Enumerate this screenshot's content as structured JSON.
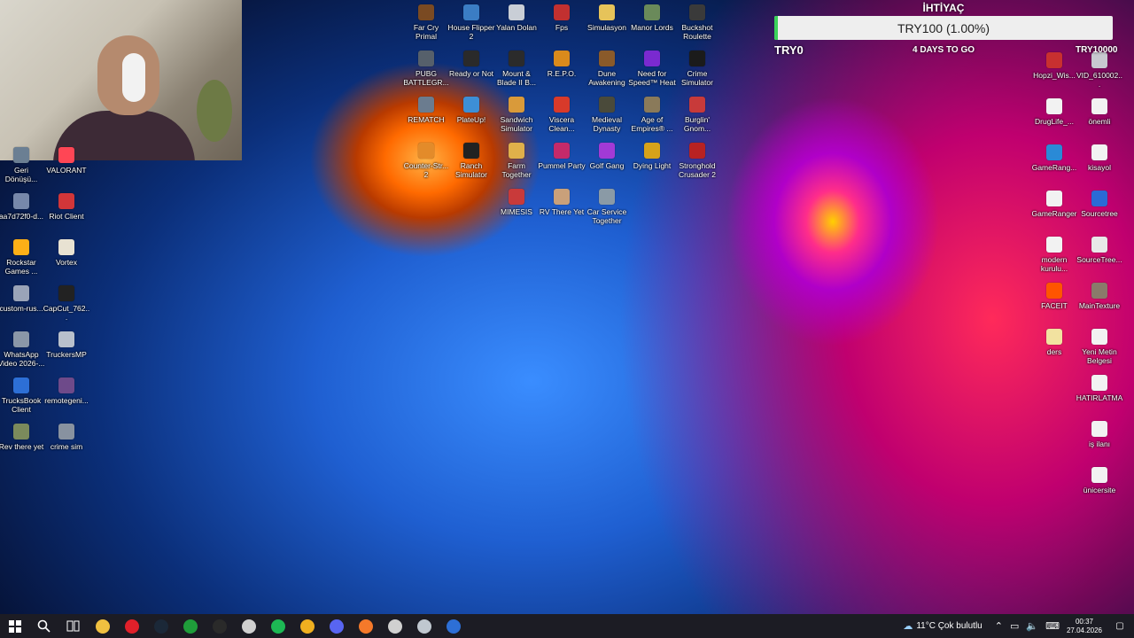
{
  "desktop": {
    "icons_left": [
      {
        "label": "Geri Dönüşü...",
        "icon": "recycle-bin-icon",
        "color": "#6b7f93"
      },
      {
        "label": "VALORANT",
        "icon": "valorant-icon",
        "color": "#ff4655"
      },
      {
        "label": "aa7d72f0-d...",
        "icon": "file-icon",
        "color": "#7788aa"
      },
      {
        "label": "Riot Client",
        "icon": "riot-client-icon",
        "color": "#d13639"
      },
      {
        "label": "Rockstar Games ...",
        "icon": "rockstar-icon",
        "color": "#fcaf17"
      },
      {
        "label": "Vortex",
        "icon": "vortex-icon",
        "color": "#e8e2d2"
      },
      {
        "label": "custom-rus...",
        "icon": "file-icon",
        "color": "#9aa4b8"
      },
      {
        "label": "CapCut_762...",
        "icon": "capcut-icon",
        "color": "#222222"
      },
      {
        "label": "WhatsApp Video 2026-...",
        "icon": "video-file-icon",
        "color": "#8a97a8"
      },
      {
        "label": "TruckersMP",
        "icon": "truckersmp-icon",
        "color": "#b8c0cc"
      },
      {
        "label": "TrucksBook Client",
        "icon": "trucksbook-icon",
        "color": "#2d6fd6"
      },
      {
        "label": "remotegeni...",
        "icon": "remotegenie-icon",
        "color": "#6e4a8a"
      },
      {
        "label": "Rev there yet",
        "icon": "shortcut-icon",
        "color": "#7b8a5c"
      },
      {
        "label": "crime sim",
        "icon": "shortcut-icon",
        "color": "#8892a0"
      }
    ],
    "icons_top": [
      {
        "label": "Far Cry Primal",
        "icon": "far-cry-primal-icon",
        "color": "#7a4a22"
      },
      {
        "label": "House Flipper 2",
        "icon": "house-flipper-icon",
        "color": "#3b7dc4"
      },
      {
        "label": "Yalan Dolan",
        "icon": "file-icon",
        "color": "#c9ced6"
      },
      {
        "label": "Fps",
        "icon": "fps-icon",
        "color": "#c23030"
      },
      {
        "label": "Simulasyon",
        "icon": "folder-icon",
        "color": "#e6c35a"
      },
      {
        "label": "Manor Lords",
        "icon": "manor-lords-icon",
        "color": "#6a8a5a"
      },
      {
        "label": "Buckshot Roulette",
        "icon": "buckshot-roulette-icon",
        "color": "#3a3a3a"
      },
      {
        "label": "PUBG BATTLEGR...",
        "icon": "pubg-icon",
        "color": "#56606b"
      },
      {
        "label": "Ready or Not",
        "icon": "ready-or-not-icon",
        "color": "#2a2a2a"
      },
      {
        "label": "Mount & Blade II B...",
        "icon": "mount-blade-icon",
        "color": "#2b2b2b"
      },
      {
        "label": "R.E.P.O.",
        "icon": "repo-icon",
        "color": "#d98a1c"
      },
      {
        "label": "Dune Awakening",
        "icon": "dune-icon",
        "color": "#8a5a2a"
      },
      {
        "label": "Need for Speed™ Heat",
        "icon": "nfs-heat-icon",
        "color": "#7a2ad0"
      },
      {
        "label": "Crime Simulator",
        "icon": "crime-simulator-icon",
        "color": "#1b1b1b"
      },
      {
        "label": "REMATCH",
        "icon": "rematch-icon",
        "color": "#6b7c8f"
      },
      {
        "label": "PlateUp!",
        "icon": "plateup-icon",
        "color": "#3d8fd6"
      },
      {
        "label": "Sandwich Simulator",
        "icon": "sandwich-icon",
        "color": "#d99a3a"
      },
      {
        "label": "Viscera Clean...",
        "icon": "viscera-icon",
        "color": "#d83a2a"
      },
      {
        "label": "Medieval Dynasty",
        "icon": "medieval-dynasty-icon",
        "color": "#4a4a3a"
      },
      {
        "label": "Age of Empires® ...",
        "icon": "aoe-icon",
        "color": "#8a7a5a"
      },
      {
        "label": "Burglin' Gnom...",
        "icon": "burglin-gnomes-icon",
        "color": "#c83a3a"
      },
      {
        "label": "Counter-Str... 2",
        "icon": "cs2-icon",
        "color": "#e38b2a"
      },
      {
        "label": "Ranch Simulator",
        "icon": "ranch-icon",
        "color": "#222222"
      },
      {
        "label": "Farm Together",
        "icon": "farm-together-icon",
        "color": "#e0b04a"
      },
      {
        "label": "Pummel Party",
        "icon": "pummel-party-icon",
        "color": "#c42a6a"
      },
      {
        "label": "Golf Gang",
        "icon": "golf-gang-icon",
        "color": "#a23ad6"
      },
      {
        "label": "Dying Light",
        "icon": "dying-light-icon",
        "color": "#d6a21a"
      },
      {
        "label": "Stronghold Crusader 2",
        "icon": "stronghold-icon",
        "color": "#b82222"
      },
      {
        "label": "MIMESIS",
        "icon": "mimesis-icon",
        "color": "#c93a3a"
      },
      {
        "label": "RV There Yet",
        "icon": "rv-there-yet-icon",
        "color": "#c9a07a"
      },
      {
        "label": "Car Service Together",
        "icon": "car-service-icon",
        "color": "#8a9aa6"
      }
    ],
    "icons_right": [
      {
        "label": "Hopzi_Wis...",
        "icon": "app-icon",
        "color": "#c83030"
      },
      {
        "label": "VID_610002...",
        "icon": "video-file-icon",
        "color": "#c8c8d0"
      },
      {
        "label": "DrugLife_...",
        "icon": "file-icon",
        "color": "#f2f2f2"
      },
      {
        "label": "önemli",
        "icon": "text-file-icon",
        "color": "#f2f2f2"
      },
      {
        "label": "GameRang...",
        "icon": "gameranger-icon",
        "color": "#2a8ad6"
      },
      {
        "label": "kisayol",
        "icon": "text-file-icon",
        "color": "#f2f2f2"
      },
      {
        "label": "GameRanger",
        "icon": "file-icon",
        "color": "#f2f2f2"
      },
      {
        "label": "Sourcetree",
        "icon": "sourcetree-icon",
        "color": "#2a6ad6"
      },
      {
        "label": "modern kurulu...",
        "icon": "text-file-icon",
        "color": "#f2f2f2"
      },
      {
        "label": "SourceTree...",
        "icon": "archive-icon",
        "color": "#e8e8e8"
      },
      {
        "label": "FACEIT",
        "icon": "faceit-icon",
        "color": "#ff5500"
      },
      {
        "label": "MainTexture",
        "icon": "image-file-icon",
        "color": "#8a7a6a"
      },
      {
        "label": "ders",
        "icon": "folder-icon",
        "color": "#f2e2a0"
      },
      {
        "label": "Yeni Metin Belgesi",
        "icon": "text-file-icon",
        "color": "#f2f2f2"
      },
      {
        "label": "HATIRLATMA",
        "icon": "text-file-icon",
        "color": "#f2f2f2"
      },
      {
        "label": "iş ilanı",
        "icon": "text-file-icon",
        "color": "#f2f2f2"
      },
      {
        "label": "ünicersite",
        "icon": "text-file-icon",
        "color": "#f2f2f2"
      }
    ]
  },
  "goal": {
    "title": "İHTİYAÇ",
    "bar_text": "TRY100 (1.00%)",
    "progress": 0.01,
    "min_label": "TRY0",
    "days_label": "4 DAYS TO GO",
    "max_label": "TRY10000",
    "fill_color": "#3bd25a"
  },
  "taskbar": {
    "apps": [
      {
        "name": "file-explorer-icon",
        "color": "#f0c040"
      },
      {
        "name": "opera-icon",
        "color": "#e0202a"
      },
      {
        "name": "steam-icon",
        "color": "#1b2838"
      },
      {
        "name": "xbox-icon",
        "color": "#1f9d3a"
      },
      {
        "name": "epic-games-icon",
        "color": "#2a2a2a"
      },
      {
        "name": "app-icon",
        "color": "#d0d0d0"
      },
      {
        "name": "spotify-icon",
        "color": "#1db954"
      },
      {
        "name": "chrome-icon",
        "color": "#f0b020"
      },
      {
        "name": "discord-icon",
        "color": "#5865f2"
      },
      {
        "name": "blender-icon",
        "color": "#f5792a"
      },
      {
        "name": "recorder-icon",
        "color": "#d0d0d0"
      },
      {
        "name": "truck-app-icon",
        "color": "#c0c8d0"
      },
      {
        "name": "trucksbook-icon",
        "color": "#2d6fd6"
      }
    ],
    "weather": "11°C Çok bulutlu",
    "time": "00:37",
    "date": "27.04.2026"
  }
}
